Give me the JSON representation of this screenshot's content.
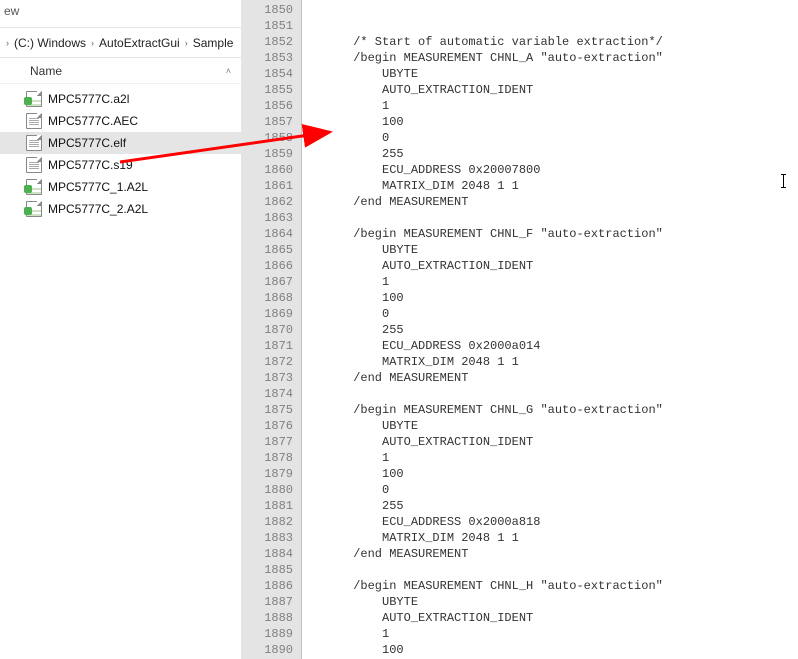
{
  "explorer": {
    "ribbon_label": "ew",
    "breadcrumb": [
      "(C:) Windows",
      "AutoExtractGui",
      "Sample"
    ],
    "column_header": "Name",
    "files": [
      {
        "name": "MPC5777C.a2l",
        "icon": "a2l",
        "selected": false
      },
      {
        "name": "MPC5777C.AEC",
        "icon": "plain",
        "selected": false
      },
      {
        "name": "MPC5777C.elf",
        "icon": "plain",
        "selected": true
      },
      {
        "name": "MPC5777C.s19",
        "icon": "plain",
        "selected": false
      },
      {
        "name": "MPC5777C_1.A2L",
        "icon": "a2l",
        "selected": false
      },
      {
        "name": "MPC5777C_2.A2L",
        "icon": "a2l",
        "selected": false
      }
    ]
  },
  "editor": {
    "first_line_no": 1850,
    "lines": [
      "",
      "",
      "      /* Start of automatic variable extraction*/",
      "      /begin MEASUREMENT CHNL_A \"auto-extraction\"",
      "          UBYTE",
      "          AUTO_EXTRACTION_IDENT",
      "          1",
      "          100",
      "          0",
      "          255",
      "          ECU_ADDRESS 0x20007800",
      "          MATRIX_DIM 2048 1 1",
      "      /end MEASUREMENT",
      "",
      "      /begin MEASUREMENT CHNL_F \"auto-extraction\"",
      "          UBYTE",
      "          AUTO_EXTRACTION_IDENT",
      "          1",
      "          100",
      "          0",
      "          255",
      "          ECU_ADDRESS 0x2000a014",
      "          MATRIX_DIM 2048 1 1",
      "      /end MEASUREMENT",
      "",
      "      /begin MEASUREMENT CHNL_G \"auto-extraction\"",
      "          UBYTE",
      "          AUTO_EXTRACTION_IDENT",
      "          1",
      "          100",
      "          0",
      "          255",
      "          ECU_ADDRESS 0x2000a818",
      "          MATRIX_DIM 2048 1 1",
      "      /end MEASUREMENT",
      "",
      "      /begin MEASUREMENT CHNL_H \"auto-extraction\"",
      "          UBYTE",
      "          AUTO_EXTRACTION_IDENT",
      "          1",
      "          100"
    ]
  }
}
